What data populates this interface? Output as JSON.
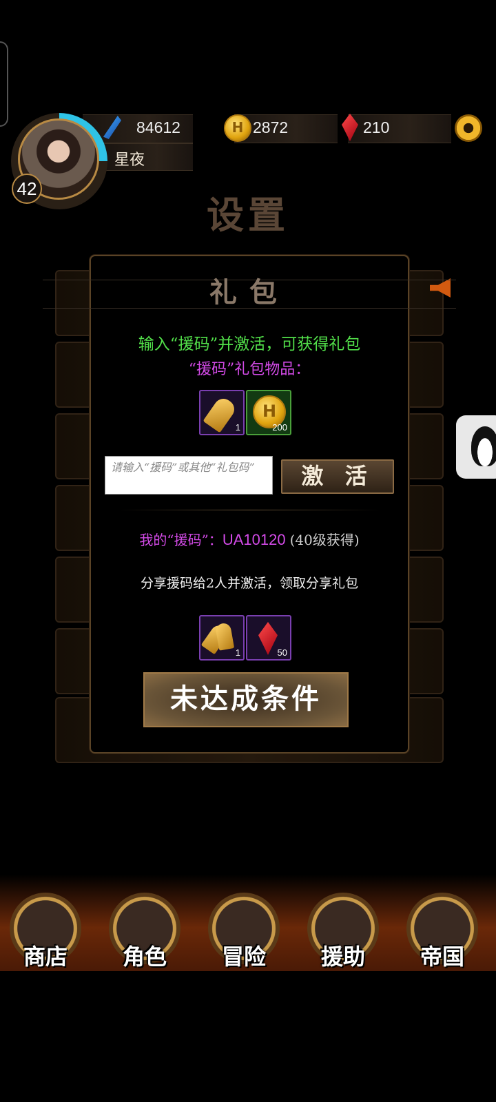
{
  "header": {
    "feathers": "84612",
    "gold": "2872",
    "gems": "210",
    "player_name": "星夜",
    "level": "42",
    "coin_letter": "H"
  },
  "page_title": "设置",
  "dialog": {
    "title": "礼包",
    "instruction": "输入“援码”并激活，可获得礼包",
    "reward_heading": "“援码”礼包物品：",
    "rewards": [
      {
        "name": "key",
        "count": "1"
      },
      {
        "name": "gold-coin",
        "count": "200"
      }
    ],
    "code_input_placeholder": "请输入“援码”或其他“礼包码”",
    "activate_label": "激 活",
    "my_code_label": "我的“援码”：",
    "my_code_value": "UA10120",
    "my_code_note": "(40级获得)",
    "share_text": "分享援码给2人并激活，领取分享礼包",
    "share_rewards": [
      {
        "name": "keys",
        "count": "1"
      },
      {
        "name": "red-gem",
        "count": "50"
      }
    ],
    "condition_button": "未达成条件"
  },
  "nav": [
    {
      "label": "商店"
    },
    {
      "label": "角色"
    },
    {
      "label": "冒险"
    },
    {
      "label": "援助"
    },
    {
      "label": "帝国"
    }
  ],
  "colors": {
    "green_text": "#52e04a",
    "purple_text": "#d24ae6",
    "accent_gold": "#b88a44"
  }
}
